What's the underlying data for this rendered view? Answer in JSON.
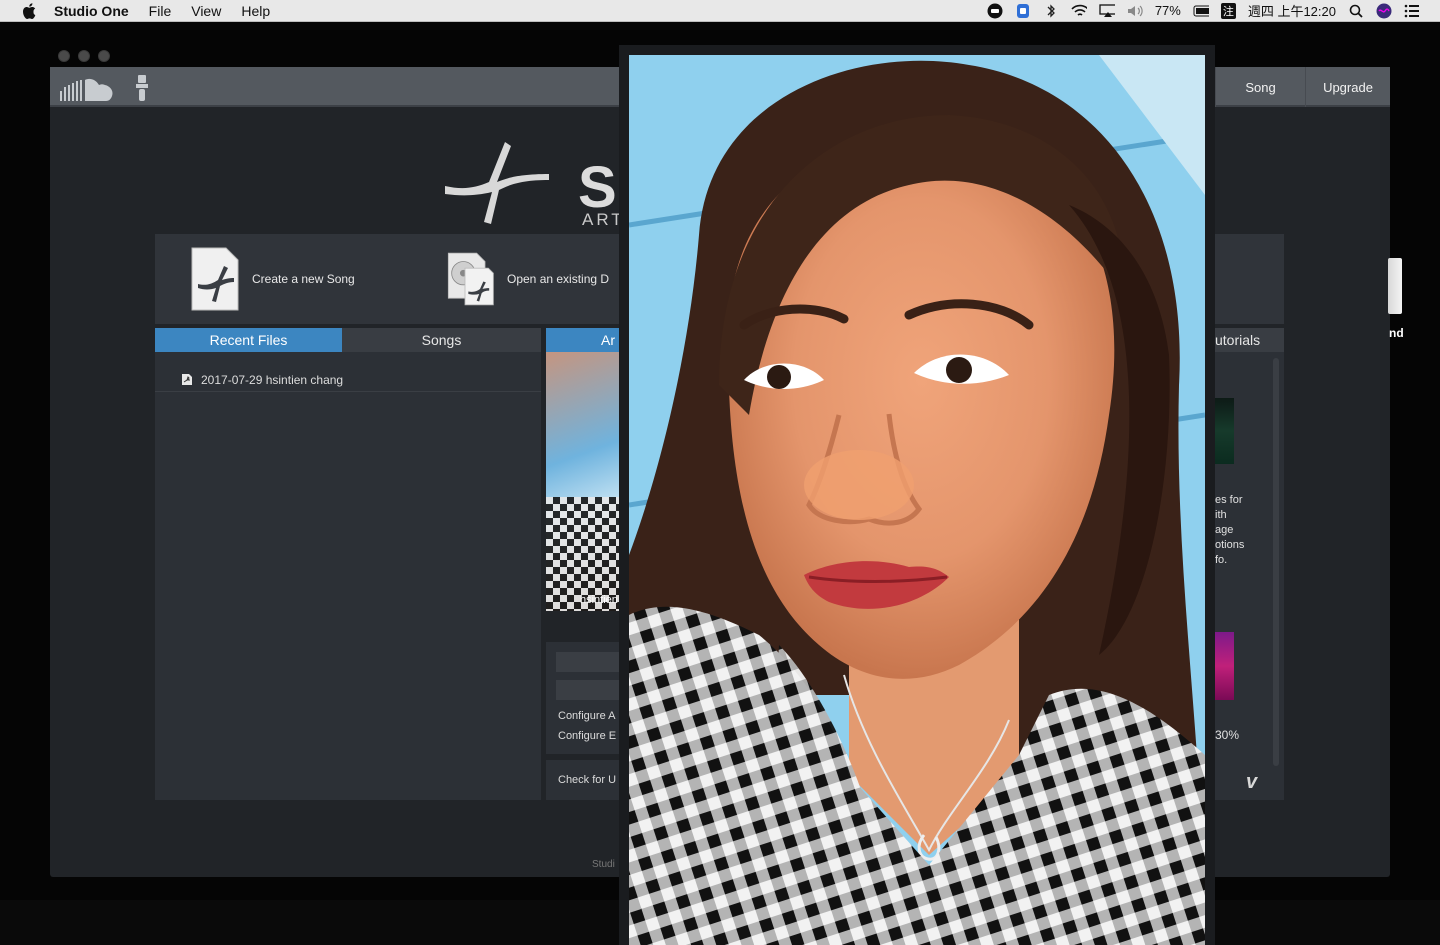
{
  "menubar": {
    "app_name": "Studio One",
    "menus": [
      "File",
      "View",
      "Help"
    ],
    "battery": "77%",
    "clock": "週四 上午12:20",
    "input_method": "注"
  },
  "toolbar": {
    "song_label": "Song",
    "upgrade_label": "Upgrade"
  },
  "logo": {
    "letter": "S",
    "sub": "ART"
  },
  "start": {
    "create_label": "Create a new Song",
    "open_label": "Open an existing D"
  },
  "left_panel": {
    "tabs": [
      "Recent Files",
      "Songs"
    ],
    "recent_files": [
      "2017-07-29 hsintien chang"
    ]
  },
  "middle_panel": {
    "tab_label": "Ar",
    "artist_name": "hsintien",
    "configure_1": "Configure A",
    "configure_2": "Configure E",
    "check_updates": "Check for U",
    "footer": "Studi"
  },
  "right_panel": {
    "tab_label": "utorials",
    "text": "es for\nith\nage\notions\nfo.",
    "percent": "30%",
    "vimeo": "v"
  },
  "desktop": {
    "drive_label": "nd"
  },
  "colors": {
    "accent_blue": "#3c86c1",
    "panel_dark": "#2c3036",
    "window_bg": "#212428"
  }
}
